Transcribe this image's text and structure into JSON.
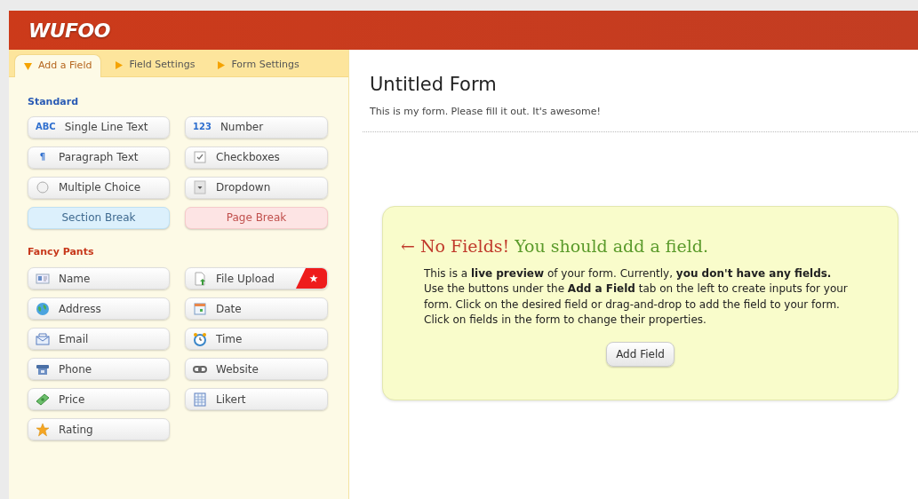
{
  "header": {
    "logo": "WUFOO"
  },
  "tabs": [
    {
      "label": "Add a Field",
      "selected": true
    },
    {
      "label": "Field Settings",
      "selected": false
    },
    {
      "label": "Form Settings",
      "selected": false
    }
  ],
  "standard": {
    "title": "Standard",
    "fields": [
      {
        "label": "Single Line Text",
        "kind": "field",
        "glyph": "ABC"
      },
      {
        "label": "Number",
        "kind": "field",
        "glyph": "123"
      },
      {
        "label": "Paragraph Text",
        "kind": "field",
        "glyph": "¶"
      },
      {
        "label": "Checkboxes",
        "kind": "field"
      },
      {
        "label": "Multiple Choice",
        "kind": "field"
      },
      {
        "label": "Dropdown",
        "kind": "field"
      },
      {
        "label": "Section Break",
        "kind": "section-break"
      },
      {
        "label": "Page Break",
        "kind": "page-break"
      }
    ]
  },
  "fancy_pants": {
    "title": "Fancy Pants",
    "fields": [
      {
        "label": "Name",
        "featured": false
      },
      {
        "label": "File Upload",
        "featured": true
      },
      {
        "label": "Address",
        "featured": false
      },
      {
        "label": "Date",
        "featured": false
      },
      {
        "label": "Email",
        "featured": false
      },
      {
        "label": "Time",
        "featured": false
      },
      {
        "label": "Phone",
        "featured": false
      },
      {
        "label": "Website",
        "featured": false
      },
      {
        "label": "Price",
        "featured": false
      },
      {
        "label": "Likert",
        "featured": false
      },
      {
        "label": "Rating",
        "featured": false
      }
    ]
  },
  "form": {
    "title": "Untitled Form",
    "description": "This is my form. Please fill it out. It's awesome!"
  },
  "notice": {
    "alert": "← No Fields!",
    "heading": "You should add a field.",
    "body": "This is a **live preview** of your form. Currently, **you don't have any fields.** Use the buttons under the **Add a Field** tab on the left to create inputs for your form. Click on the desired field or drag-and-drop to add the field to your form. Click on fields in the form to change their properties.",
    "button": "Add Field"
  }
}
